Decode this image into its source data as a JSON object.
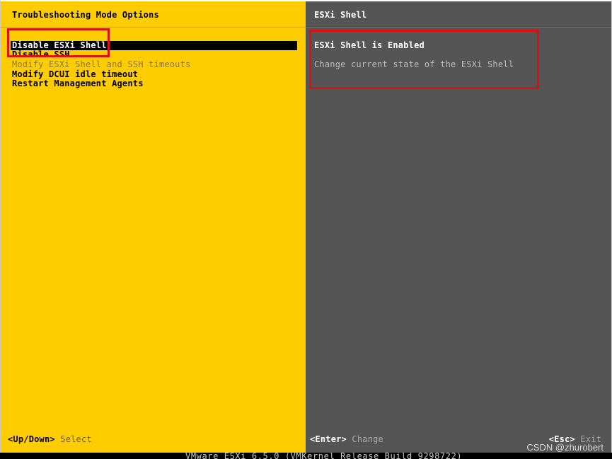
{
  "left_panel": {
    "title": "Troubleshooting Mode Options",
    "background": "#FFCC00",
    "menu_items": [
      {
        "label": "Disable ESXi Shell",
        "state": "selected"
      },
      {
        "label": "Disable SSH",
        "state": "normal"
      },
      {
        "label": "Modify ESXi Shell and SSH timeouts",
        "state": "disabled"
      },
      {
        "label": "Modify DCUI idle timeout",
        "state": "normal"
      },
      {
        "label": "Restart Management Agents",
        "state": "normal"
      }
    ],
    "hint": {
      "key": "<Up/Down>",
      "action": "Select"
    }
  },
  "right_panel": {
    "title": "ESXi Shell",
    "background": "#555555",
    "status_heading": "ESXi Shell is Enabled",
    "description": "Change current state of the ESXi Shell",
    "hint_enter": {
      "key": "<Enter>",
      "action": "Change"
    },
    "hint_esc": {
      "key": "<Esc>",
      "action": "Exit"
    }
  },
  "footer": {
    "build_text": "VMware ESXi 6.5.0 (VMKernel Release Build 9298722)"
  },
  "watermark": "CSDN @zhurobert",
  "annotation_color": "#E01010"
}
